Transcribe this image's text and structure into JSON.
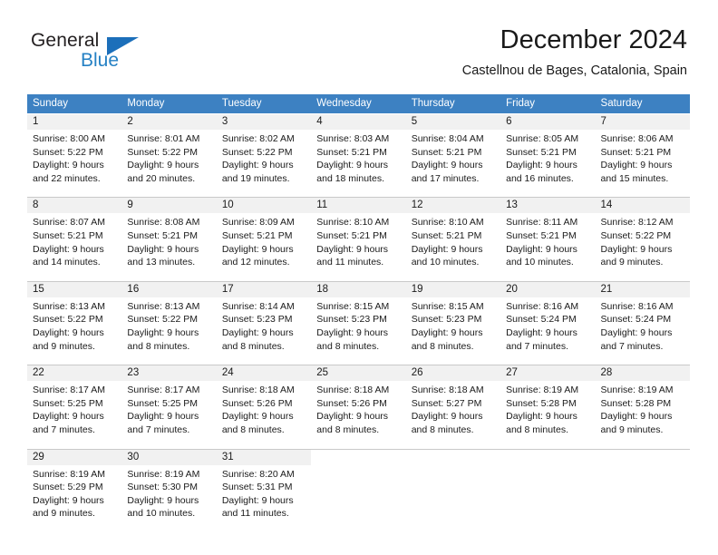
{
  "logo": {
    "word_one": "General",
    "word_two": "Blue",
    "triangle_color": "#1c6fba",
    "blue_color": "#2581c4"
  },
  "header": {
    "title": "December 2024",
    "subtitle": "Castellnou de Bages, Catalonia, Spain"
  },
  "calendar": {
    "header_color": "#3d81c2",
    "daynum_band_color": "#f1f1f1",
    "weekdays": [
      "Sunday",
      "Monday",
      "Tuesday",
      "Wednesday",
      "Thursday",
      "Friday",
      "Saturday"
    ],
    "weeks": [
      [
        {
          "day": "1",
          "sunrise": "Sunrise: 8:00 AM",
          "sunset": "Sunset: 5:22 PM",
          "daylight1": "Daylight: 9 hours",
          "daylight2": "and 22 minutes."
        },
        {
          "day": "2",
          "sunrise": "Sunrise: 8:01 AM",
          "sunset": "Sunset: 5:22 PM",
          "daylight1": "Daylight: 9 hours",
          "daylight2": "and 20 minutes."
        },
        {
          "day": "3",
          "sunrise": "Sunrise: 8:02 AM",
          "sunset": "Sunset: 5:22 PM",
          "daylight1": "Daylight: 9 hours",
          "daylight2": "and 19 minutes."
        },
        {
          "day": "4",
          "sunrise": "Sunrise: 8:03 AM",
          "sunset": "Sunset: 5:21 PM",
          "daylight1": "Daylight: 9 hours",
          "daylight2": "and 18 minutes."
        },
        {
          "day": "5",
          "sunrise": "Sunrise: 8:04 AM",
          "sunset": "Sunset: 5:21 PM",
          "daylight1": "Daylight: 9 hours",
          "daylight2": "and 17 minutes."
        },
        {
          "day": "6",
          "sunrise": "Sunrise: 8:05 AM",
          "sunset": "Sunset: 5:21 PM",
          "daylight1": "Daylight: 9 hours",
          "daylight2": "and 16 minutes."
        },
        {
          "day": "7",
          "sunrise": "Sunrise: 8:06 AM",
          "sunset": "Sunset: 5:21 PM",
          "daylight1": "Daylight: 9 hours",
          "daylight2": "and 15 minutes."
        }
      ],
      [
        {
          "day": "8",
          "sunrise": "Sunrise: 8:07 AM",
          "sunset": "Sunset: 5:21 PM",
          "daylight1": "Daylight: 9 hours",
          "daylight2": "and 14 minutes."
        },
        {
          "day": "9",
          "sunrise": "Sunrise: 8:08 AM",
          "sunset": "Sunset: 5:21 PM",
          "daylight1": "Daylight: 9 hours",
          "daylight2": "and 13 minutes."
        },
        {
          "day": "10",
          "sunrise": "Sunrise: 8:09 AM",
          "sunset": "Sunset: 5:21 PM",
          "daylight1": "Daylight: 9 hours",
          "daylight2": "and 12 minutes."
        },
        {
          "day": "11",
          "sunrise": "Sunrise: 8:10 AM",
          "sunset": "Sunset: 5:21 PM",
          "daylight1": "Daylight: 9 hours",
          "daylight2": "and 11 minutes."
        },
        {
          "day": "12",
          "sunrise": "Sunrise: 8:10 AM",
          "sunset": "Sunset: 5:21 PM",
          "daylight1": "Daylight: 9 hours",
          "daylight2": "and 10 minutes."
        },
        {
          "day": "13",
          "sunrise": "Sunrise: 8:11 AM",
          "sunset": "Sunset: 5:21 PM",
          "daylight1": "Daylight: 9 hours",
          "daylight2": "and 10 minutes."
        },
        {
          "day": "14",
          "sunrise": "Sunrise: 8:12 AM",
          "sunset": "Sunset: 5:22 PM",
          "daylight1": "Daylight: 9 hours",
          "daylight2": "and 9 minutes."
        }
      ],
      [
        {
          "day": "15",
          "sunrise": "Sunrise: 8:13 AM",
          "sunset": "Sunset: 5:22 PM",
          "daylight1": "Daylight: 9 hours",
          "daylight2": "and 9 minutes."
        },
        {
          "day": "16",
          "sunrise": "Sunrise: 8:13 AM",
          "sunset": "Sunset: 5:22 PM",
          "daylight1": "Daylight: 9 hours",
          "daylight2": "and 8 minutes."
        },
        {
          "day": "17",
          "sunrise": "Sunrise: 8:14 AM",
          "sunset": "Sunset: 5:23 PM",
          "daylight1": "Daylight: 9 hours",
          "daylight2": "and 8 minutes."
        },
        {
          "day": "18",
          "sunrise": "Sunrise: 8:15 AM",
          "sunset": "Sunset: 5:23 PM",
          "daylight1": "Daylight: 9 hours",
          "daylight2": "and 8 minutes."
        },
        {
          "day": "19",
          "sunrise": "Sunrise: 8:15 AM",
          "sunset": "Sunset: 5:23 PM",
          "daylight1": "Daylight: 9 hours",
          "daylight2": "and 8 minutes."
        },
        {
          "day": "20",
          "sunrise": "Sunrise: 8:16 AM",
          "sunset": "Sunset: 5:24 PM",
          "daylight1": "Daylight: 9 hours",
          "daylight2": "and 7 minutes."
        },
        {
          "day": "21",
          "sunrise": "Sunrise: 8:16 AM",
          "sunset": "Sunset: 5:24 PM",
          "daylight1": "Daylight: 9 hours",
          "daylight2": "and 7 minutes."
        }
      ],
      [
        {
          "day": "22",
          "sunrise": "Sunrise: 8:17 AM",
          "sunset": "Sunset: 5:25 PM",
          "daylight1": "Daylight: 9 hours",
          "daylight2": "and 7 minutes."
        },
        {
          "day": "23",
          "sunrise": "Sunrise: 8:17 AM",
          "sunset": "Sunset: 5:25 PM",
          "daylight1": "Daylight: 9 hours",
          "daylight2": "and 7 minutes."
        },
        {
          "day": "24",
          "sunrise": "Sunrise: 8:18 AM",
          "sunset": "Sunset: 5:26 PM",
          "daylight1": "Daylight: 9 hours",
          "daylight2": "and 8 minutes."
        },
        {
          "day": "25",
          "sunrise": "Sunrise: 8:18 AM",
          "sunset": "Sunset: 5:26 PM",
          "daylight1": "Daylight: 9 hours",
          "daylight2": "and 8 minutes."
        },
        {
          "day": "26",
          "sunrise": "Sunrise: 8:18 AM",
          "sunset": "Sunset: 5:27 PM",
          "daylight1": "Daylight: 9 hours",
          "daylight2": "and 8 minutes."
        },
        {
          "day": "27",
          "sunrise": "Sunrise: 8:19 AM",
          "sunset": "Sunset: 5:28 PM",
          "daylight1": "Daylight: 9 hours",
          "daylight2": "and 8 minutes."
        },
        {
          "day": "28",
          "sunrise": "Sunrise: 8:19 AM",
          "sunset": "Sunset: 5:28 PM",
          "daylight1": "Daylight: 9 hours",
          "daylight2": "and 9 minutes."
        }
      ],
      [
        {
          "day": "29",
          "sunrise": "Sunrise: 8:19 AM",
          "sunset": "Sunset: 5:29 PM",
          "daylight1": "Daylight: 9 hours",
          "daylight2": "and 9 minutes."
        },
        {
          "day": "30",
          "sunrise": "Sunrise: 8:19 AM",
          "sunset": "Sunset: 5:30 PM",
          "daylight1": "Daylight: 9 hours",
          "daylight2": "and 10 minutes."
        },
        {
          "day": "31",
          "sunrise": "Sunrise: 8:20 AM",
          "sunset": "Sunset: 5:31 PM",
          "daylight1": "Daylight: 9 hours",
          "daylight2": "and 11 minutes."
        },
        {
          "day": "",
          "sunrise": "",
          "sunset": "",
          "daylight1": "",
          "daylight2": ""
        },
        {
          "day": "",
          "sunrise": "",
          "sunset": "",
          "daylight1": "",
          "daylight2": ""
        },
        {
          "day": "",
          "sunrise": "",
          "sunset": "",
          "daylight1": "",
          "daylight2": ""
        },
        {
          "day": "",
          "sunrise": "",
          "sunset": "",
          "daylight1": "",
          "daylight2": ""
        }
      ]
    ]
  }
}
